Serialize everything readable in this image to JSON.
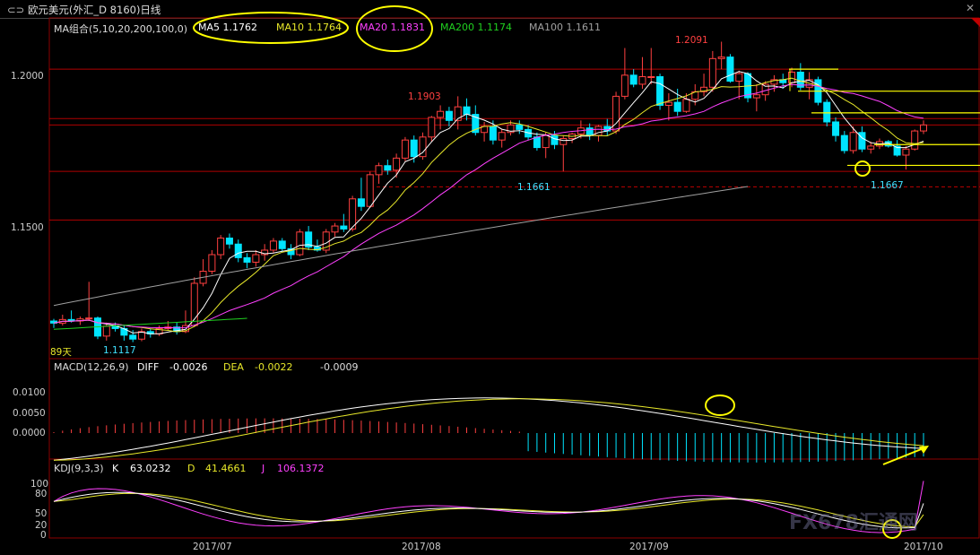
{
  "window": {
    "title": "欧元美元(外汇_D 8160)日线",
    "icon": "link-icon",
    "close_icon": "close-icon"
  },
  "main_panel": {
    "indicator_name": "MA组合(5,10,20,200,100,0)",
    "ma_labels": [
      {
        "text": "MA5 1.1762",
        "color": "#ffffff"
      },
      {
        "text": "MA10 1.1764",
        "color": "#e8e82a"
      },
      {
        "text": "MA20 1.1831",
        "color": "#ff40ff"
      },
      {
        "text": "MA200 1.1174",
        "color": "#20d020"
      },
      {
        "text": "MA100 1.1611",
        "color": "#a0a0a0"
      }
    ],
    "y_ticks": [
      "1.2000",
      "1.1500"
    ],
    "days_label": "89天",
    "annotations": [
      "1.2091",
      "1.1903",
      "1.1661",
      "1.1667",
      "1.1117"
    ]
  },
  "macd_panel": {
    "header": "MACD(12,26,9)",
    "diff_label": "DIFF",
    "diff_value": "-0.0026",
    "dea_label": "DEA",
    "dea_value": "-0.0022",
    "macd_value": "-0.0009",
    "y_ticks": [
      "0.0100",
      "0.0050",
      "0.0000"
    ]
  },
  "kdj_panel": {
    "header": "KDJ(9,3,3)",
    "k_label": "K",
    "k_value": "63.0232",
    "d_label": "D",
    "d_value": "41.4661",
    "j_label": "J",
    "j_value": "106.1372",
    "y_ticks": [
      "100",
      "80",
      "50",
      "20",
      "0"
    ]
  },
  "x_axis": {
    "labels": [
      "2017/07",
      "2017/08",
      "2017/09",
      "2017/10"
    ]
  },
  "watermark": "FX678汇通网",
  "colors": {
    "up": "#ff4040",
    "down": "#00e5ff",
    "grid": "#8b0000",
    "ma5": "#ffffff",
    "ma10": "#e8e82a",
    "ma20": "#ff40ff",
    "ma100": "#a0a0a0",
    "ma200": "#20d020",
    "highlight": "#ffff00"
  },
  "chart_data": {
    "type": "candlestick",
    "title": "欧元美元(外汇_D 8160)日线",
    "x_range": [
      "2017/06/21",
      "2017/10/09"
    ],
    "ylim": [
      1.107,
      1.214
    ],
    "candles": [
      [
        1.1165,
        1.1172,
        1.1142,
        1.1158
      ],
      [
        1.1158,
        1.1186,
        1.115,
        1.117
      ],
      [
        1.117,
        1.12,
        1.116,
        1.1165
      ],
      [
        1.1165,
        1.118,
        1.1152,
        1.1172
      ],
      [
        1.1172,
        1.1295,
        1.1165,
        1.1175
      ],
      [
        1.1175,
        1.118,
        1.1105,
        1.1115
      ],
      [
        1.1115,
        1.116,
        1.11,
        1.1148
      ],
      [
        1.1148,
        1.116,
        1.113,
        1.114
      ],
      [
        1.114,
        1.115,
        1.11,
        1.1118
      ],
      [
        1.1118,
        1.1135,
        1.1095,
        1.1105
      ],
      [
        1.1105,
        1.114,
        1.1098,
        1.113
      ],
      [
        1.113,
        1.114,
        1.111,
        1.1122
      ],
      [
        1.1122,
        1.115,
        1.1115,
        1.114
      ],
      [
        1.114,
        1.1165,
        1.1135,
        1.1145
      ],
      [
        1.1145,
        1.116,
        1.112,
        1.113
      ],
      [
        1.113,
        1.12,
        1.1125,
        1.115
      ],
      [
        1.115,
        1.131,
        1.1145,
        1.129
      ],
      [
        1.129,
        1.137,
        1.128,
        1.133
      ],
      [
        1.133,
        1.14,
        1.132,
        1.1385
      ],
      [
        1.1385,
        1.145,
        1.137,
        1.144
      ],
      [
        1.144,
        1.1455,
        1.1405,
        1.142
      ],
      [
        1.142,
        1.1435,
        1.136,
        1.1375
      ],
      [
        1.1375,
        1.139,
        1.134,
        1.136
      ],
      [
        1.136,
        1.14,
        1.1345,
        1.1385
      ],
      [
        1.1385,
        1.142,
        1.1365,
        1.14
      ],
      [
        1.14,
        1.144,
        1.139,
        1.143
      ],
      [
        1.143,
        1.144,
        1.1395,
        1.1405
      ],
      [
        1.1405,
        1.142,
        1.137,
        1.1385
      ],
      [
        1.1385,
        1.147,
        1.138,
        1.146
      ],
      [
        1.146,
        1.148,
        1.14,
        1.141
      ],
      [
        1.141,
        1.1435,
        1.1395,
        1.14
      ],
      [
        1.14,
        1.147,
        1.139,
        1.146
      ],
      [
        1.146,
        1.149,
        1.1445,
        1.148
      ],
      [
        1.148,
        1.152,
        1.146,
        1.147
      ],
      [
        1.147,
        1.158,
        1.1462,
        1.157
      ],
      [
        1.157,
        1.164,
        1.153,
        1.1545
      ],
      [
        1.1545,
        1.166,
        1.154,
        1.165
      ],
      [
        1.165,
        1.169,
        1.162,
        1.168
      ],
      [
        1.168,
        1.17,
        1.165,
        1.1665
      ],
      [
        1.1665,
        1.172,
        1.164,
        1.1705
      ],
      [
        1.1705,
        1.1775,
        1.1695,
        1.1765
      ],
      [
        1.1765,
        1.178,
        1.169,
        1.171
      ],
      [
        1.171,
        1.179,
        1.17,
        1.1775
      ],
      [
        1.1775,
        1.1845,
        1.176,
        1.184
      ],
      [
        1.184,
        1.188,
        1.18,
        1.186
      ],
      [
        1.186,
        1.1875,
        1.181,
        1.183
      ],
      [
        1.183,
        1.191,
        1.18,
        1.1875
      ],
      [
        1.1875,
        1.1903,
        1.183,
        1.185
      ],
      [
        1.185,
        1.188,
        1.178,
        1.179
      ],
      [
        1.179,
        1.1825,
        1.176,
        1.181
      ],
      [
        1.181,
        1.183,
        1.175,
        1.1765
      ],
      [
        1.1765,
        1.18,
        1.174,
        1.179
      ],
      [
        1.179,
        1.183,
        1.178,
        1.1815
      ],
      [
        1.1815,
        1.183,
        1.1785,
        1.18
      ],
      [
        1.18,
        1.1815,
        1.1765,
        1.1775
      ],
      [
        1.1775,
        1.179,
        1.173,
        1.174
      ],
      [
        1.174,
        1.179,
        1.1705,
        1.178
      ],
      [
        1.178,
        1.1795,
        1.1735,
        1.175
      ],
      [
        1.175,
        1.178,
        1.1661,
        1.177
      ],
      [
        1.177,
        1.179,
        1.1755,
        1.1785
      ],
      [
        1.1785,
        1.183,
        1.177,
        1.1805
      ],
      [
        1.1805,
        1.182,
        1.1765,
        1.178
      ],
      [
        1.178,
        1.1815,
        1.176,
        1.181
      ],
      [
        1.181,
        1.1835,
        1.178,
        1.1795
      ],
      [
        1.1795,
        1.1925,
        1.1785,
        1.191
      ],
      [
        1.191,
        1.207,
        1.19,
        1.198
      ],
      [
        1.198,
        1.2,
        1.194,
        1.195
      ],
      [
        1.195,
        1.204,
        1.1935,
        1.1975
      ],
      [
        1.1975,
        1.207,
        1.195,
        1.1975
      ],
      [
        1.1975,
        1.1985,
        1.1865,
        1.188
      ],
      [
        1.188,
        1.192,
        1.183,
        1.189
      ],
      [
        1.189,
        1.1935,
        1.1845,
        1.186
      ],
      [
        1.186,
        1.192,
        1.1855,
        1.19
      ],
      [
        1.19,
        1.195,
        1.188,
        1.1925
      ],
      [
        1.1925,
        1.1985,
        1.191,
        1.194
      ],
      [
        1.194,
        1.206,
        1.1925,
        1.2035
      ],
      [
        1.2035,
        1.2091,
        1.2,
        1.204
      ],
      [
        1.204,
        1.205,
        1.1955,
        1.196
      ],
      [
        1.196,
        1.1995,
        1.19,
        1.1985
      ],
      [
        1.1985,
        1.199,
        1.189,
        1.1905
      ],
      [
        1.1905,
        1.195,
        1.186,
        1.1915
      ],
      [
        1.1915,
        1.196,
        1.1895,
        1.195
      ],
      [
        1.195,
        1.198,
        1.1925,
        1.1965
      ],
      [
        1.1965,
        1.1985,
        1.1935,
        1.1955
      ],
      [
        1.1955,
        1.2005,
        1.194,
        1.199
      ],
      [
        1.199,
        1.202,
        1.193,
        1.194
      ],
      [
        1.194,
        1.199,
        1.19,
        1.1965
      ],
      [
        1.1965,
        1.1975,
        1.188,
        1.189
      ],
      [
        1.189,
        1.19,
        1.181,
        1.1825
      ],
      [
        1.1825,
        1.184,
        1.176,
        1.178
      ],
      [
        1.178,
        1.1795,
        1.172,
        1.173
      ],
      [
        1.173,
        1.181,
        1.172,
        1.179
      ],
      [
        1.179,
        1.181,
        1.1725,
        1.1735
      ],
      [
        1.1735,
        1.176,
        1.172,
        1.1745
      ],
      [
        1.1745,
        1.177,
        1.1735,
        1.176
      ],
      [
        1.176,
        1.1765,
        1.174,
        1.1745
      ],
      [
        1.1745,
        1.1765,
        1.171,
        1.1715
      ],
      [
        1.1715,
        1.1745,
        1.1667,
        1.1735
      ],
      [
        1.1735,
        1.18,
        1.173,
        1.1795
      ],
      [
        1.1795,
        1.183,
        1.1785,
        1.1815
      ]
    ],
    "ma_series": [
      {
        "name": "MA5",
        "last": 1.1762
      },
      {
        "name": "MA10",
        "last": 1.1764
      },
      {
        "name": "MA20",
        "last": 1.1831
      },
      {
        "name": "MA200",
        "last": 1.1174
      },
      {
        "name": "MA100",
        "last": 1.1611
      }
    ],
    "macd": {
      "diff": -0.0026,
      "dea": -0.0022,
      "macd": -0.0009,
      "ylim": [
        -0.006,
        0.014
      ]
    },
    "kdj": {
      "k": 63.0232,
      "d": 41.4661,
      "j": 106.1372,
      "ylim": [
        0,
        120
      ]
    }
  }
}
